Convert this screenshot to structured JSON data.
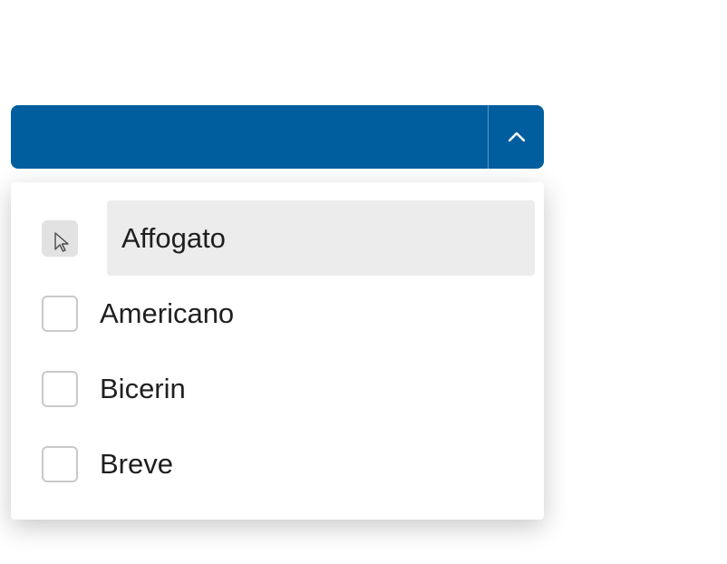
{
  "dropdown": {
    "expanded": true,
    "options": [
      {
        "label": "Affogato",
        "highlighted": true
      },
      {
        "label": "Americano",
        "highlighted": false
      },
      {
        "label": "Bicerin",
        "highlighted": false
      },
      {
        "label": "Breve",
        "highlighted": false
      }
    ]
  }
}
